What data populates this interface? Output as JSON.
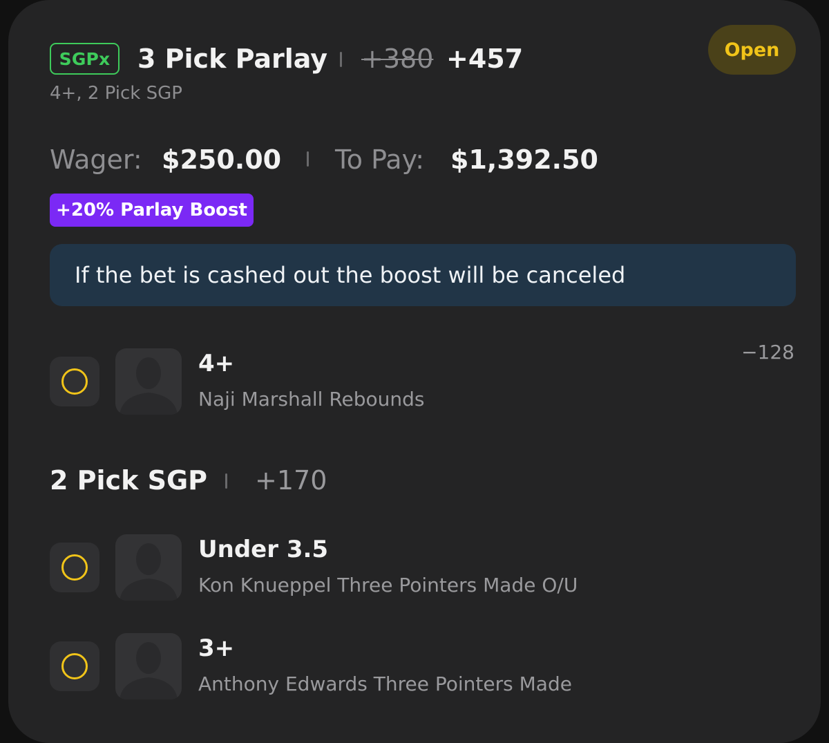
{
  "bet": {
    "badge": "SGPx",
    "title": "3 Pick Parlay",
    "original_odds": "+380",
    "boosted_odds": "+457",
    "subtitle": "4+, 2 Pick SGP",
    "status": "Open",
    "wager_label": "Wager:",
    "wager_value": "$250.00",
    "pay_label": "To Pay:",
    "pay_value": "$1,392.50",
    "boost_label": "+20% Parlay Boost",
    "notice": "If the bet is cashed out the boost will be canceled"
  },
  "picks": [
    {
      "line": "4+",
      "description": "Naji Marshall Rebounds",
      "odds": "−128",
      "icon": "circle-outline-icon"
    }
  ],
  "sgp_group": {
    "title": "2 Pick SGP",
    "odds": "+170",
    "picks": [
      {
        "line": "Under 3.5",
        "description": "Kon Knueppel Three Pointers Made O/U",
        "icon": "circle-outline-icon"
      },
      {
        "line": "3+",
        "description": "Anthony Edwards Three Pointers Made",
        "icon": "circle-outline-icon"
      }
    ]
  },
  "colors": {
    "accent_green": "#3ecb5b",
    "status_yellow": "#f1c419",
    "boost_purple": "#7b29f5",
    "notice_bg": "#213547",
    "card_bg": "#242425"
  }
}
